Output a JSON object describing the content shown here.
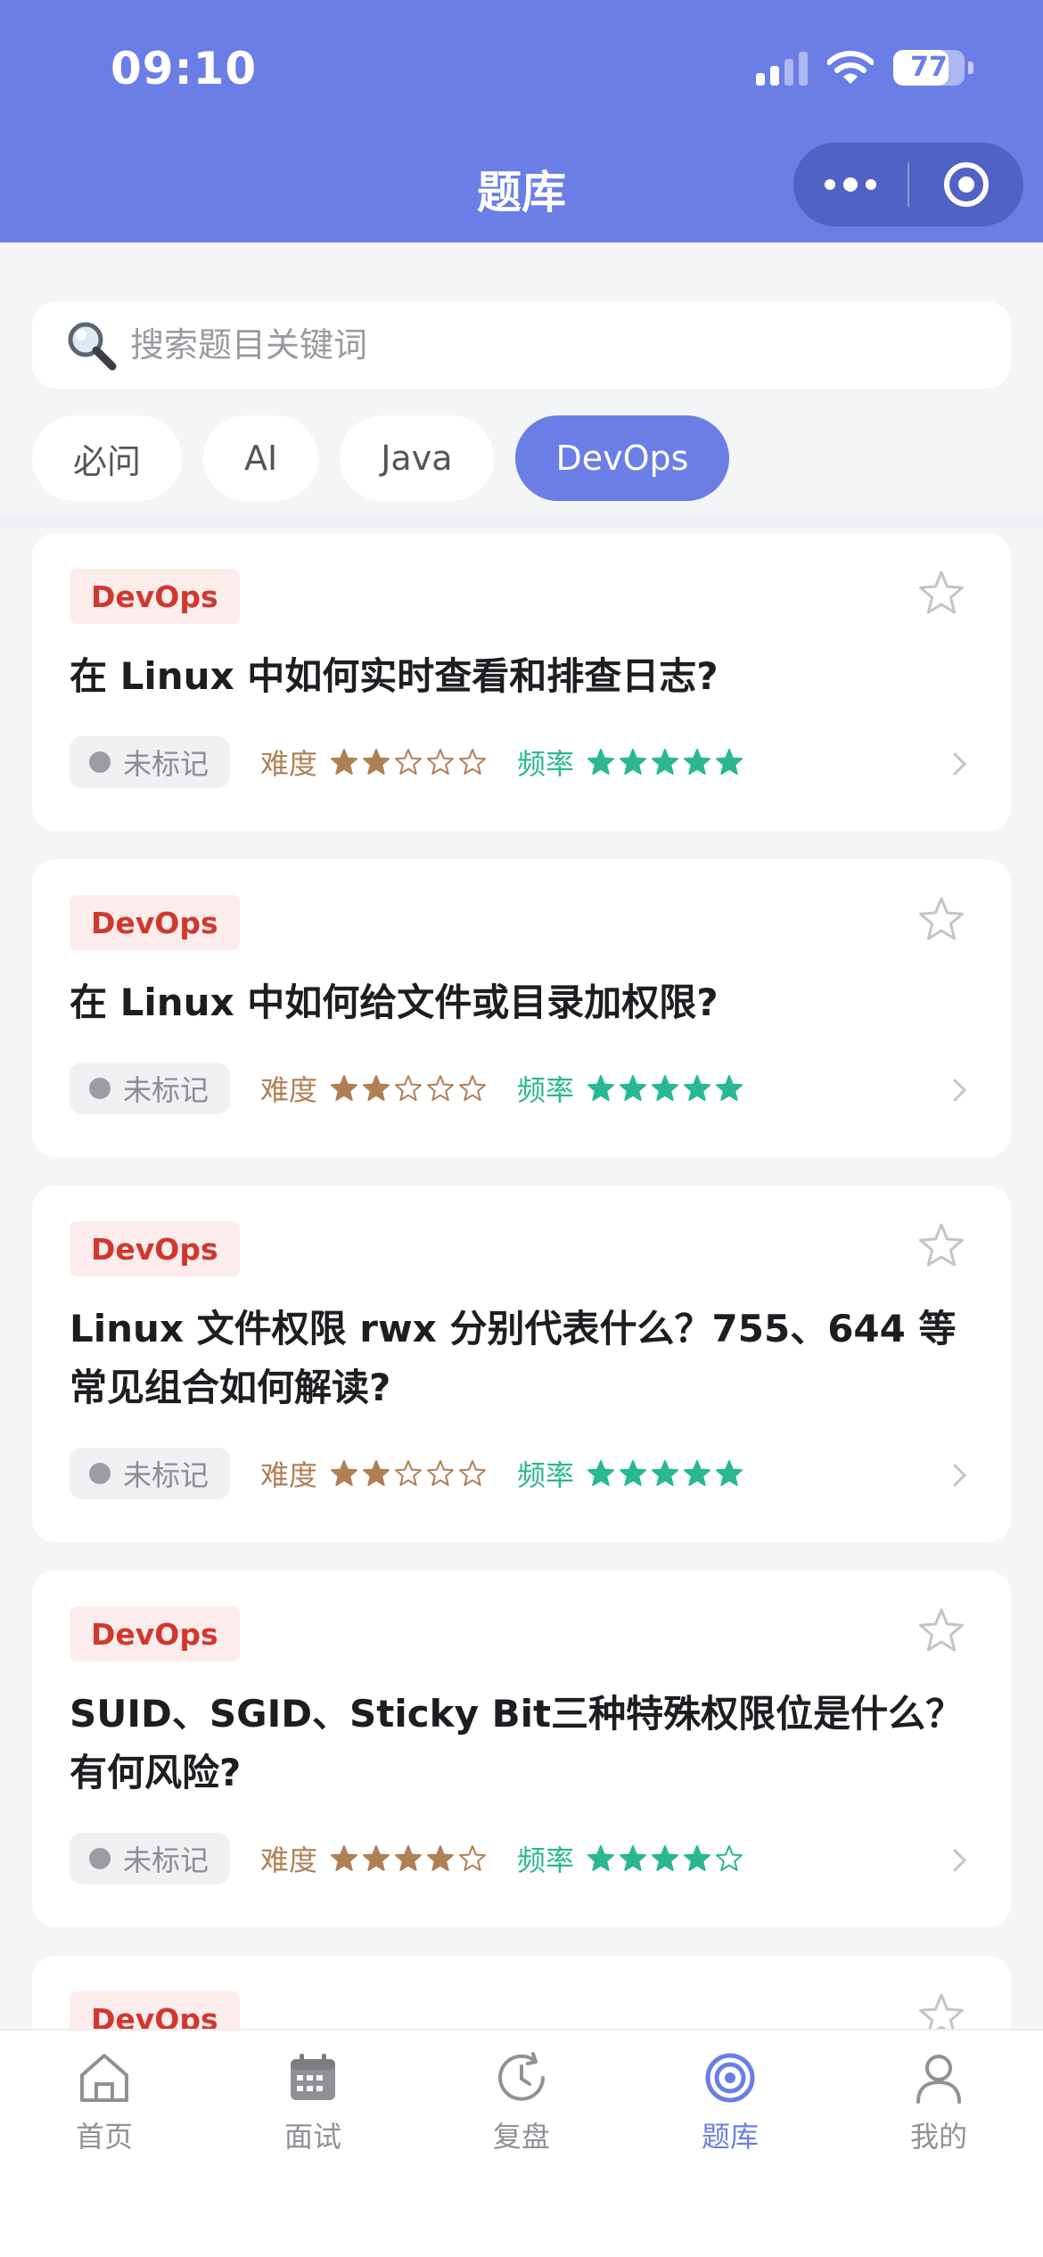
{
  "status_bar": {
    "time": "09:10",
    "battery": "77",
    "battery_level": 0.77
  },
  "header": {
    "title": "题库"
  },
  "search": {
    "placeholder": "搜索题目关键词"
  },
  "filters": [
    {
      "label": "必问",
      "active": false
    },
    {
      "label": "AI",
      "active": false
    },
    {
      "label": "Java",
      "active": false
    },
    {
      "label": "DevOps",
      "active": true
    }
  ],
  "questions": [
    {
      "tag": "DevOps",
      "title": "在 Linux 中如何实时查看和排查日志?",
      "status": "未标记",
      "difficulty_label": "难度",
      "difficulty": 2,
      "frequency_label": "频率",
      "frequency": 5
    },
    {
      "tag": "DevOps",
      "title": "在 Linux 中如何给文件或目录加权限?",
      "status": "未标记",
      "difficulty_label": "难度",
      "difficulty": 2,
      "frequency_label": "频率",
      "frequency": 5
    },
    {
      "tag": "DevOps",
      "title": "Linux 文件权限 rwx 分别代表什么？755、644 等常见组合如何解读?",
      "status": "未标记",
      "difficulty_label": "难度",
      "difficulty": 2,
      "frequency_label": "频率",
      "frequency": 5
    },
    {
      "tag": "DevOps",
      "title": "SUID、SGID、Sticky Bit三种特殊权限位是什么？有何风险?",
      "status": "未标记",
      "difficulty_label": "难度",
      "difficulty": 4,
      "frequency_label": "频率",
      "frequency": 4
    },
    {
      "tag": "DevOps"
    }
  ],
  "tabbar": {
    "items": [
      {
        "label": "首页",
        "icon": "home-icon",
        "active": false
      },
      {
        "label": "面试",
        "icon": "calendar-icon",
        "active": false
      },
      {
        "label": "复盘",
        "icon": "review-clock-icon",
        "active": false
      },
      {
        "label": "题库",
        "icon": "target-icon",
        "active": true
      },
      {
        "label": "我的",
        "icon": "user-icon",
        "active": false
      }
    ]
  },
  "colors": {
    "primary": "#6b7ee6",
    "tag_text": "#d0382e",
    "tag_bg": "#fdecec",
    "difficulty": "#b08055",
    "frequency": "#29b88f"
  }
}
